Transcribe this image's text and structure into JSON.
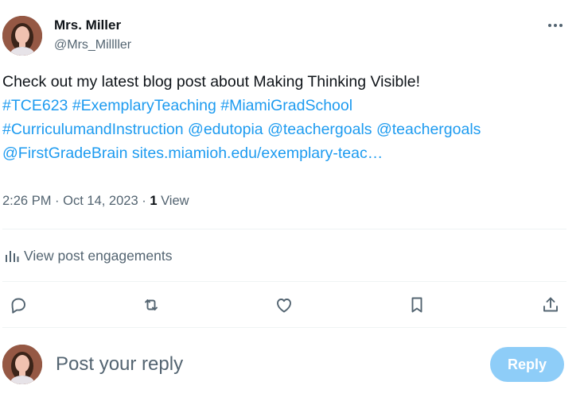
{
  "post": {
    "author": {
      "display_name": "Mrs. Miller",
      "handle": "@Mrs_Millller",
      "avatar_icon": "profile-photo"
    },
    "text_segments": [
      {
        "text": "Check out my latest blog post about Making Thinking Visible!",
        "type": "text"
      },
      {
        "text": "#TCE623",
        "type": "hashtag"
      },
      {
        "text": "#ExemplaryTeaching",
        "type": "hashtag"
      },
      {
        "text": "#MiamiGradSchool",
        "type": "hashtag"
      },
      {
        "text": "#CurriculumandInstruction",
        "type": "hashtag"
      },
      {
        "text": "@edutopia",
        "type": "mention"
      },
      {
        "text": "@teachergoals",
        "type": "mention"
      },
      {
        "text": "@teachergoals",
        "type": "mention"
      },
      {
        "text": "@FirstGradeBrain",
        "type": "mention"
      },
      {
        "text": "sites.miamioh.edu/exemplary-teac…",
        "type": "url"
      }
    ],
    "time": "2:26 PM",
    "date": "Oct 14, 2023",
    "separator": "·",
    "views_count": "1",
    "views_label": "View"
  },
  "engagements": {
    "label": "View post engagements",
    "icon": "analytics-icon"
  },
  "actions": [
    {
      "name": "reply",
      "icon": "reply-icon"
    },
    {
      "name": "repost",
      "icon": "repost-icon"
    },
    {
      "name": "like",
      "icon": "like-icon"
    },
    {
      "name": "bookmark",
      "icon": "bookmark-icon"
    },
    {
      "name": "share",
      "icon": "share-icon"
    }
  ],
  "composer": {
    "placeholder": "Post your reply",
    "value": "",
    "button_label": "Reply"
  },
  "colors": {
    "link": "#1d9bf0",
    "secondary_text": "#536471",
    "reply_button_disabled": "#8ecdf8",
    "divider": "#eff3f4"
  }
}
